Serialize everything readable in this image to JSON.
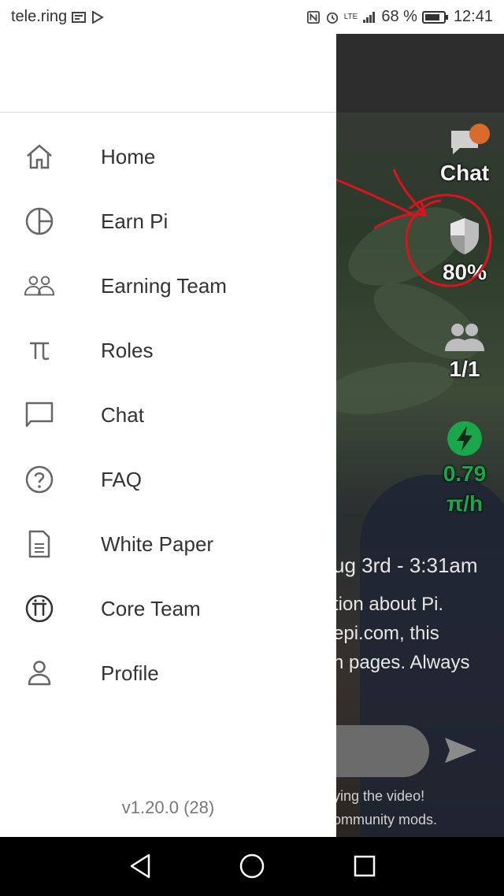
{
  "status_bar": {
    "carrier": "tele.ring",
    "network": "LTE",
    "battery": "68 %",
    "time": "12:41"
  },
  "drawer": {
    "items": [
      {
        "label": "Home",
        "icon": "home-icon"
      },
      {
        "label": "Earn Pi",
        "icon": "pie-chart-icon"
      },
      {
        "label": "Earning Team",
        "icon": "team-icon"
      },
      {
        "label": "Roles",
        "icon": "pi-symbol-icon"
      },
      {
        "label": "Chat",
        "icon": "chat-icon"
      },
      {
        "label": "FAQ",
        "icon": "question-icon"
      },
      {
        "label": "White Paper",
        "icon": "document-icon"
      },
      {
        "label": "Core Team",
        "icon": "pi-logo-icon"
      },
      {
        "label": "Profile",
        "icon": "person-icon"
      }
    ],
    "version": "v1.20.0 (28)"
  },
  "background_app": {
    "chat_label": "Chat",
    "security_value": "80%",
    "team_value": "1/1",
    "mining_rate": "0.79",
    "mining_unit": "π/h",
    "timestamp": "ug 3rd - 3:31am",
    "text_line_1": "tion about Pi.",
    "text_line_2": "epi.com, this",
    "text_line_3": "n pages. Always",
    "footer_line_1": "ying the video!",
    "footer_line_2": "ommunity mods."
  },
  "colors": {
    "drawer_bg": "#ffffff",
    "menu_text": "#333333",
    "icon_gray": "#666666",
    "mining_green": "#1aa64a",
    "annotation_red": "#d8141c"
  }
}
